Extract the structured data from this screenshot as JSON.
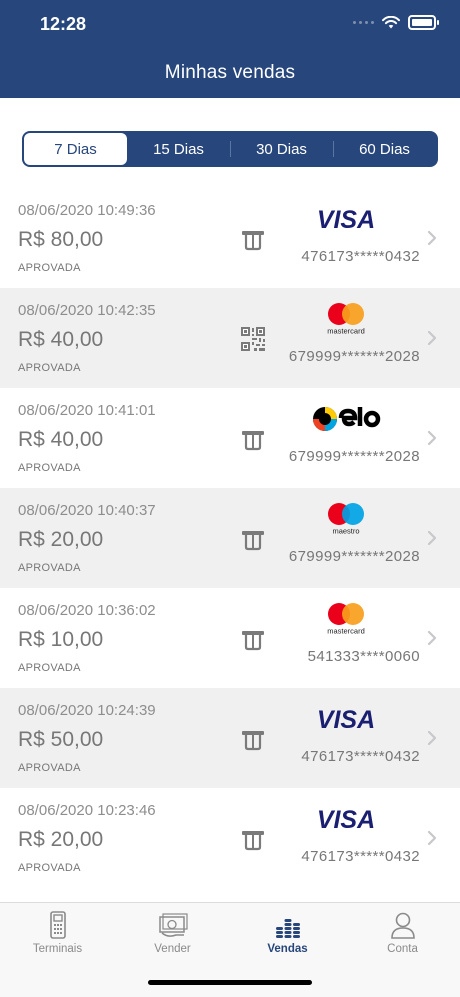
{
  "status_bar": {
    "time": "12:28"
  },
  "header": {
    "title": "Minhas vendas"
  },
  "periods": [
    {
      "label": "7 Dias",
      "active": true
    },
    {
      "label": "15 Dias",
      "active": false
    },
    {
      "label": "30 Dias",
      "active": false
    },
    {
      "label": "60 Dias",
      "active": false
    }
  ],
  "sales": [
    {
      "datetime": "08/06/2020 10:49:36",
      "amount": "R$ 80,00",
      "status": "APROVADA",
      "method_icon": "card-icon",
      "brand": "visa",
      "card": "476173*****0432"
    },
    {
      "datetime": "08/06/2020 10:42:35",
      "amount": "R$ 40,00",
      "status": "APROVADA",
      "method_icon": "qr-code-icon",
      "brand": "mastercard",
      "brand_text": "mastercard",
      "card": "679999*******2028"
    },
    {
      "datetime": "08/06/2020 10:41:01",
      "amount": "R$ 40,00",
      "status": "APROVADA",
      "method_icon": "card-icon",
      "brand": "elo",
      "card": "679999*******2028"
    },
    {
      "datetime": "08/06/2020 10:40:37",
      "amount": "R$ 20,00",
      "status": "APROVADA",
      "method_icon": "card-icon",
      "brand": "maestro",
      "brand_text": "maestro",
      "card": "679999*******2028"
    },
    {
      "datetime": "08/06/2020 10:36:02",
      "amount": "R$ 10,00",
      "status": "APROVADA",
      "method_icon": "card-icon",
      "brand": "mastercard",
      "brand_text": "mastercard",
      "card": "541333****0060"
    },
    {
      "datetime": "08/06/2020 10:24:39",
      "amount": "R$ 50,00",
      "status": "APROVADA",
      "method_icon": "card-icon",
      "brand": "visa",
      "card": "476173*****0432"
    },
    {
      "datetime": "08/06/2020 10:23:46",
      "amount": "R$ 20,00",
      "status": "APROVADA",
      "method_icon": "card-icon",
      "brand": "visa",
      "card": "476173*****0432"
    }
  ],
  "tabs": [
    {
      "label": "Terminais",
      "icon": "terminal-icon",
      "active": false
    },
    {
      "label": "Vender",
      "icon": "sell-icon",
      "active": false
    },
    {
      "label": "Vendas",
      "icon": "coins-icon",
      "active": true
    },
    {
      "label": "Conta",
      "icon": "user-icon",
      "active": false
    }
  ],
  "colors": {
    "primary": "#27467b",
    "visa": "#1a1f71",
    "mc_red": "#eb001b",
    "mc_orange": "#f79e1b",
    "maestro_blue": "#00a2e5",
    "elo_yellow": "#ffcb05",
    "elo_blue": "#00a4e0",
    "elo_red": "#ef4123"
  }
}
